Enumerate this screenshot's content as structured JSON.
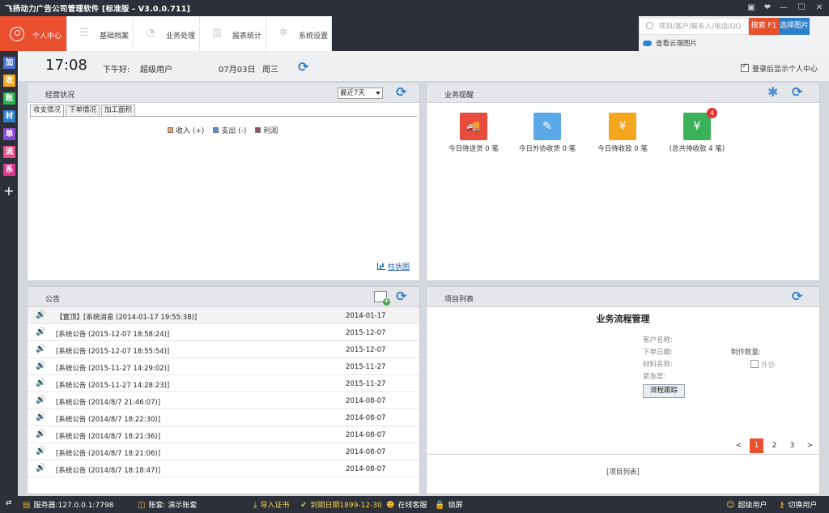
{
  "window": {
    "title": "飞扬动力广告公司管理软件 [标准版 - V3.0.0.711]",
    "controls": [
      "▣",
      "❤",
      "—",
      "☐",
      "✕"
    ]
  },
  "nav": {
    "tabs": [
      {
        "label": "个人中心",
        "icon": "user-icon"
      },
      {
        "label": "基础档案",
        "icon": "list-icon"
      },
      {
        "label": "业务处理",
        "icon": "gauge-icon"
      },
      {
        "label": "报表统计",
        "icon": "bar-chart-icon"
      },
      {
        "label": "系统设置",
        "icon": "gear-icon"
      }
    ]
  },
  "search": {
    "placeholder": "项目/客户/联系人/电话/QQ",
    "search_label": "搜索 F1",
    "pick_label": "选择图片",
    "cloud_label": "查看云端图片"
  },
  "quickbar": {
    "items": [
      {
        "label": "加",
        "color": "#4a6fd6"
      },
      {
        "label": "收",
        "color": "#f2a81d"
      },
      {
        "label": "账",
        "color": "#2bb24c"
      },
      {
        "label": "材",
        "color": "#2f7fc8"
      },
      {
        "label": "单",
        "color": "#8a4bd1"
      },
      {
        "label": "流",
        "color": "#e8508a"
      },
      {
        "label": "系",
        "color": "#d9398c"
      }
    ],
    "add": "+"
  },
  "info": {
    "time": "17:08",
    "greeting": "下午好:",
    "user": "超级用户",
    "date": "07月03日",
    "weekday": "周三",
    "show_on_login": "登录后显示个人中心"
  },
  "business": {
    "title": "经营状况",
    "period": "最近7天",
    "subtabs": [
      "收支情况",
      "下单情况",
      "加工面积"
    ],
    "legend": [
      {
        "label": "收入 (+)",
        "color": "#f0a35a"
      },
      {
        "label": "支出 (-)",
        "color": "#5b8dd6"
      },
      {
        "label": "利润",
        "color": "#9a4e6a"
      }
    ],
    "chart_link": "柱状图"
  },
  "reminders": {
    "title": "业务提醒",
    "items": [
      {
        "label": "今日待送货 0 笔",
        "color": "#e84c3d",
        "icon": "truck-icon",
        "glyph": "🚚"
      },
      {
        "label": "今日外协收货 0 笔",
        "color": "#5aa9e6",
        "icon": "edit-icon",
        "glyph": "✎"
      },
      {
        "label": "今日待收款 0 笔",
        "color": "#f4a61c",
        "icon": "yen-icon",
        "glyph": "¥"
      },
      {
        "label": "(总共待收款 4 笔)",
        "color": "#3db05a",
        "icon": "yen-icon",
        "glyph": "¥",
        "badge": "4"
      }
    ]
  },
  "notices": {
    "title": "公告",
    "rows": [
      {
        "text": "【置顶】[系统消息 (2014-01-17 19:55:38)]",
        "date": "2014-01-17"
      },
      {
        "text": "[系统公告 (2015-12-07 18:58:24)]",
        "date": "2015-12-07"
      },
      {
        "text": "[系统公告 (2015-12-07 18:55:54)]",
        "date": "2015-12-07"
      },
      {
        "text": "[系统公告 (2015-11-27 14:29:02)]",
        "date": "2015-11-27"
      },
      {
        "text": "[系统公告 (2015-11-27 14:28:23)]",
        "date": "2015-11-27"
      },
      {
        "text": "[系统公告 (2014/8/7 21:46:07)]",
        "date": "2014-08-07"
      },
      {
        "text": "[系统公告 (2014/8/7 18:22:30)]",
        "date": "2014-08-07"
      },
      {
        "text": "[系统公告 (2014/8/7 18:21:36)]",
        "date": "2014-08-07"
      },
      {
        "text": "[系统公告 (2014/8/7 18:21:06)]",
        "date": "2014-08-07"
      },
      {
        "text": "[系统公告 (2014/8/7 18:18:47)]",
        "date": "2014-08-07"
      }
    ]
  },
  "projects": {
    "title": "项目列表",
    "flow_title": "业务流程管理",
    "fields": {
      "customer": "客户名称:",
      "order_date": "下单日期:",
      "material": "材料名称:",
      "urgency": "紧急度:",
      "quantity": "制作数量:",
      "outsource": "外协"
    },
    "track_button": "流程跟踪",
    "pager": {
      "prev": "<",
      "pages": [
        "1",
        "2",
        "3"
      ],
      "next": ">",
      "current": "1"
    },
    "list_label": "[项目列表]"
  },
  "status": {
    "swap": "⇄",
    "server": "服务器:127.0.0.1:7798",
    "account": "账套: 演示账套",
    "import_cert": "导入证书",
    "expire": "到期日期1899-12-30",
    "service": "在线客服",
    "lock": "锁屏",
    "user": "超级用户",
    "switch_user": "切换用户"
  }
}
